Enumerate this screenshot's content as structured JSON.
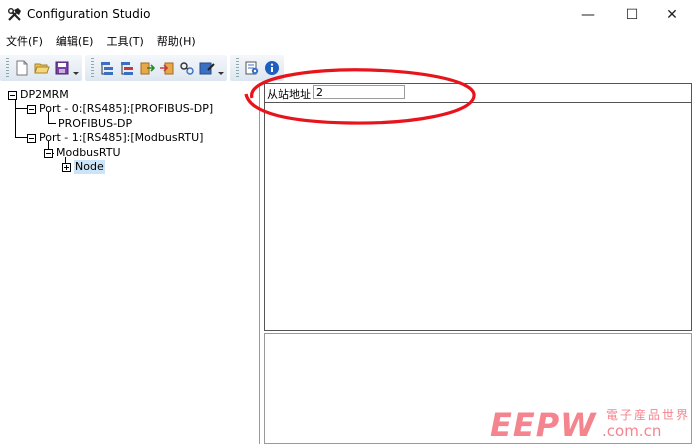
{
  "window": {
    "title": "Configuration Studio",
    "controls": {
      "minimize": "—",
      "maximize": "☐",
      "close": "✕"
    }
  },
  "menu": {
    "items": [
      {
        "label": "文件(F)"
      },
      {
        "label": "编辑(E)"
      },
      {
        "label": "工具(T)"
      },
      {
        "label": "帮助(H)"
      }
    ]
  },
  "toolbar": {
    "icons": [
      "new-file-icon",
      "open-folder-icon",
      "save-icon",
      "add-item-icon",
      "delete-item-icon",
      "import-icon",
      "export-icon",
      "connect-icon",
      "edit-icon",
      "settings-icon",
      "info-icon"
    ]
  },
  "tree": {
    "root": "DP2MRM",
    "port0": "Port - 0:[RS485]:[PROFIBUS-DP]",
    "port0_child": "PROFIBUS-DP",
    "port1": "Port - 1:[RS485]:[ModbusRTU]",
    "port1_child": "ModbusRTU",
    "node": "Node"
  },
  "properties": {
    "slave_address_label": "从站地址",
    "slave_address_value": "2"
  },
  "watermark": {
    "logo": "EEPW",
    "chinese": "電子産品世界",
    "url": ".com.cn"
  },
  "colors": {
    "annotation": "#e8141b",
    "watermark": "#f36f7a",
    "selection": "#cce4f7"
  }
}
